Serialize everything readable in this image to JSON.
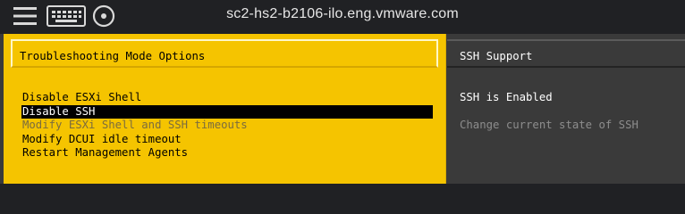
{
  "topbar": {
    "host": "sc2-hs2-b2106-ilo.eng.vmware.com",
    "icons": [
      "menu-icon",
      "keyboard-icon",
      "cdrom-icon"
    ]
  },
  "left_panel": {
    "title": "Troubleshooting Mode Options",
    "menu": [
      {
        "label": "Disable ESXi Shell",
        "state": "normal"
      },
      {
        "label": "Disable SSH",
        "state": "selected"
      },
      {
        "label": "Modify ESXi Shell and SSH timeouts",
        "state": "disabled"
      },
      {
        "label": "Modify DCUI idle timeout",
        "state": "normal"
      },
      {
        "label": "Restart Management Agents",
        "state": "normal"
      }
    ]
  },
  "right_panel": {
    "title": "SSH Support",
    "status": "SSH is Enabled",
    "help": "Change current state of SSH"
  },
  "colors": {
    "left_bg": "#f5c400",
    "right_bg": "#3a3a3a",
    "topbar_bg": "#202124",
    "selected_bg": "#000000"
  }
}
